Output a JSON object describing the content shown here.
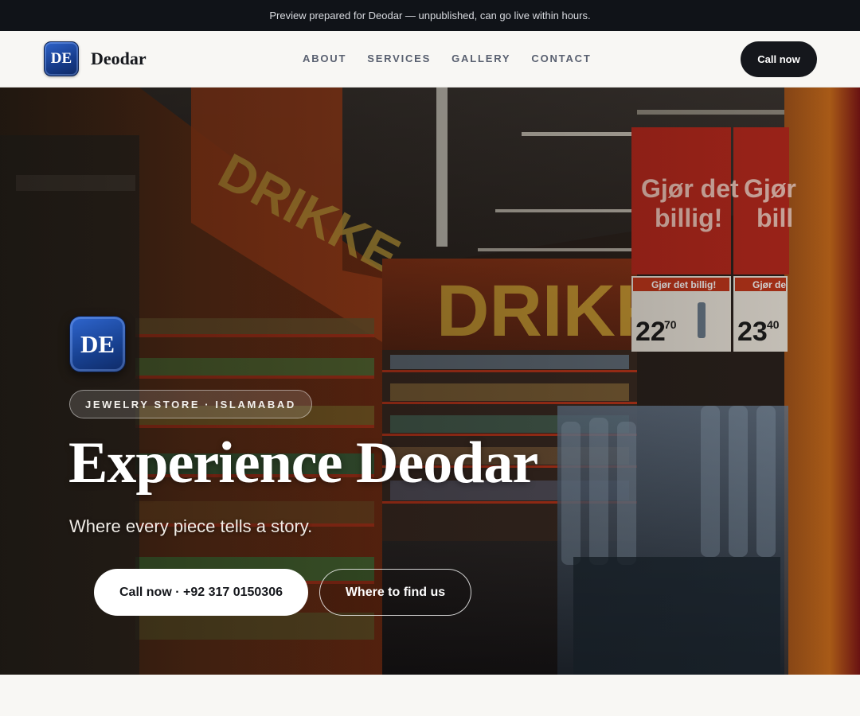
{
  "preview_banner": {
    "text": "Preview prepared for Deodar — unpublished, can go live within hours."
  },
  "nav": {
    "logo_initials": "DE",
    "brand_name": "Deodar",
    "links": [
      "ABOUT",
      "SERVICES",
      "GALLERY",
      "CONTACT"
    ],
    "cta_label": "Call now"
  },
  "hero": {
    "logo_initials": "DE",
    "badge": "JEWELRY STORE · ISLAMABAD",
    "title": "Experience Deodar",
    "subtitle": "Where every piece tells a story.",
    "primary_button": "Call now · +92 317 0150306",
    "secondary_button": "Where to find us",
    "background_image": {
      "signs": [
        "DRIKKE",
        "DRIKK",
        "Gjør det billig!",
        "Gjør det billig!"
      ],
      "shelf_tags": [
        "Gjør det billig!",
        "Gjør de"
      ],
      "prices": [
        "22",
        "70",
        "23",
        "40"
      ]
    }
  },
  "colors": {
    "dark": "#15171c",
    "preview_bar": "#101318",
    "page_bg": "#f8f7f4",
    "logo_blue": "#17408f",
    "sign_red": "#b8281c"
  }
}
